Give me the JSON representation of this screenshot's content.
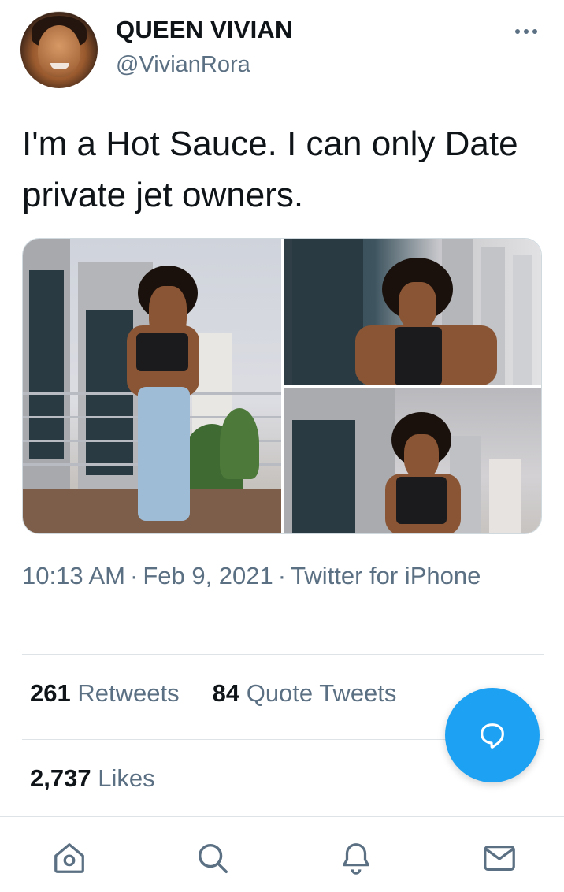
{
  "author": {
    "name": "QUEEN VIVIAN",
    "handle": "@VivianRora"
  },
  "tweet": {
    "text": "I'm a Hot Sauce. I can only Date private jet owners.",
    "time": "10:13 AM",
    "date": "Feb 9, 2021",
    "source": "Twitter for iPhone",
    "separator": "·"
  },
  "stats": {
    "retweets_count": "261",
    "retweets_label": "Retweets",
    "quote_count": "84",
    "quote_label": "Quote Tweets",
    "likes_count": "2,737",
    "likes_label": "Likes"
  },
  "icons": {
    "more": "more-options-icon",
    "compose": "reply-bubble-icon",
    "nav": [
      "home-icon",
      "search-icon",
      "notifications-icon",
      "messages-icon"
    ]
  },
  "colors": {
    "accent": "#1da1f2",
    "secondary_text": "#5b7083",
    "primary_text": "#0f1419",
    "divider": "#dde3e7"
  }
}
